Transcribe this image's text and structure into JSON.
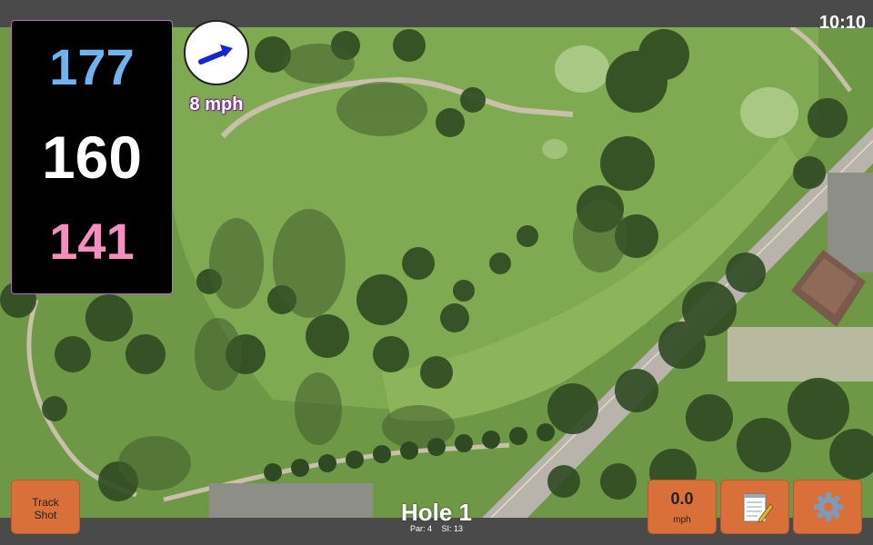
{
  "status": {
    "clock": "10:10"
  },
  "yardages": {
    "back": "177",
    "middle": "160",
    "front": "141"
  },
  "wind": {
    "speed": "8 mph",
    "icon": "wind-direction-arrow-icon"
  },
  "hole": {
    "title": "Hole 1",
    "par": "Par: 4",
    "si": "SI: 13"
  },
  "buttons": {
    "track_shot_line1": "Track",
    "track_shot_line2": "Shot",
    "speed_value": "0.0",
    "speed_unit": "mph",
    "notes_icon": "notepad-icon",
    "settings_icon": "gear-icon"
  },
  "colors": {
    "back": "#6fb4f0",
    "middle": "#ffffff",
    "front": "#f48fc0",
    "button": "#d9703a",
    "bar": "#4a4a4a"
  }
}
